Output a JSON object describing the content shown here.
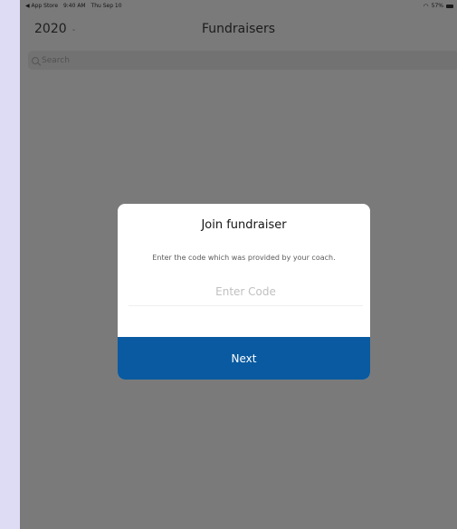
{
  "status_bar": {
    "back_app": "◀ App Store",
    "time": "9:40 AM",
    "date": "Thu Sep 10",
    "battery": "57%"
  },
  "nav": {
    "year": "2020",
    "title": "Fundraisers"
  },
  "search": {
    "placeholder": "Search"
  },
  "modal": {
    "title": "Join fundraiser",
    "subtitle": "Enter the code which was provided by your coach.",
    "input_placeholder": "Enter Code",
    "next_label": "Next"
  },
  "colors": {
    "accent": "#095aa0",
    "overlay": "#7a7a7a"
  }
}
